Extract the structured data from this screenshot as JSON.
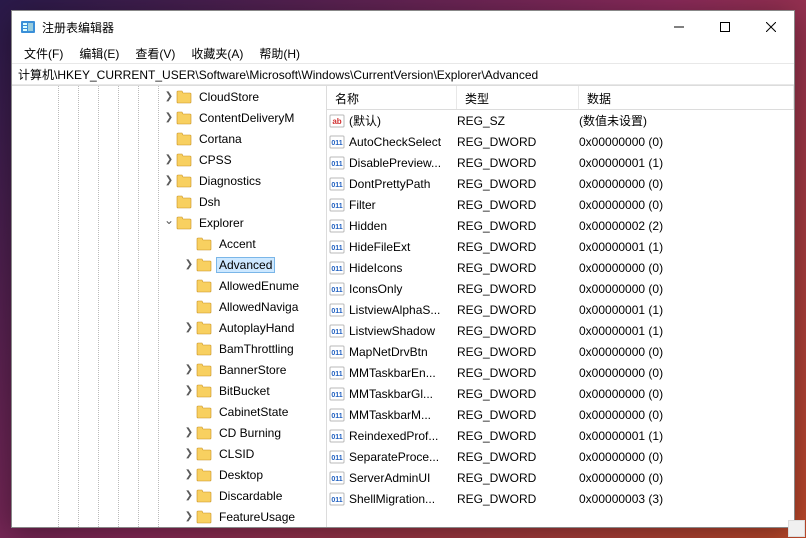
{
  "window": {
    "title": "注册表编辑器"
  },
  "menu": {
    "file": "文件(F)",
    "edit": "编辑(E)",
    "view": "查看(V)",
    "fav": "收藏夹(A)",
    "help": "帮助(H)"
  },
  "address": "计算机\\HKEY_CURRENT_USER\\Software\\Microsoft\\Windows\\CurrentVersion\\Explorer\\Advanced",
  "tree": [
    {
      "indent": 150,
      "chev": "closed",
      "label": "CloudStore"
    },
    {
      "indent": 150,
      "chev": "closed",
      "label": "ContentDeliveryM"
    },
    {
      "indent": 150,
      "chev": "empty",
      "label": "Cortana"
    },
    {
      "indent": 150,
      "chev": "closed",
      "label": "CPSS"
    },
    {
      "indent": 150,
      "chev": "closed",
      "label": "Diagnostics"
    },
    {
      "indent": 150,
      "chev": "empty",
      "label": "Dsh"
    },
    {
      "indent": 150,
      "chev": "open",
      "label": "Explorer"
    },
    {
      "indent": 170,
      "chev": "empty",
      "label": "Accent"
    },
    {
      "indent": 170,
      "chev": "closed",
      "label": "Advanced",
      "sel": true
    },
    {
      "indent": 170,
      "chev": "empty",
      "label": "AllowedEnume"
    },
    {
      "indent": 170,
      "chev": "empty",
      "label": "AllowedNaviga"
    },
    {
      "indent": 170,
      "chev": "closed",
      "label": "AutoplayHand"
    },
    {
      "indent": 170,
      "chev": "empty",
      "label": "BamThrottling"
    },
    {
      "indent": 170,
      "chev": "closed",
      "label": "BannerStore"
    },
    {
      "indent": 170,
      "chev": "closed",
      "label": "BitBucket"
    },
    {
      "indent": 170,
      "chev": "empty",
      "label": "CabinetState"
    },
    {
      "indent": 170,
      "chev": "closed",
      "label": "CD Burning"
    },
    {
      "indent": 170,
      "chev": "closed",
      "label": "CLSID"
    },
    {
      "indent": 170,
      "chev": "closed",
      "label": "Desktop"
    },
    {
      "indent": 170,
      "chev": "closed",
      "label": "Discardable"
    },
    {
      "indent": 170,
      "chev": "closed",
      "label": "FeatureUsage"
    }
  ],
  "columns": {
    "name": "名称",
    "type": "类型",
    "data": "数据"
  },
  "rows": [
    {
      "kind": "sz",
      "name": "(默认)",
      "type": "REG_SZ",
      "data": "(数值未设置)"
    },
    {
      "kind": "dw",
      "name": "AutoCheckSelect",
      "type": "REG_DWORD",
      "data": "0x00000000 (0)"
    },
    {
      "kind": "dw",
      "name": "DisablePreview...",
      "type": "REG_DWORD",
      "data": "0x00000001 (1)"
    },
    {
      "kind": "dw",
      "name": "DontPrettyPath",
      "type": "REG_DWORD",
      "data": "0x00000000 (0)"
    },
    {
      "kind": "dw",
      "name": "Filter",
      "type": "REG_DWORD",
      "data": "0x00000000 (0)"
    },
    {
      "kind": "dw",
      "name": "Hidden",
      "type": "REG_DWORD",
      "data": "0x00000002 (2)"
    },
    {
      "kind": "dw",
      "name": "HideFileExt",
      "type": "REG_DWORD",
      "data": "0x00000001 (1)"
    },
    {
      "kind": "dw",
      "name": "HideIcons",
      "type": "REG_DWORD",
      "data": "0x00000000 (0)"
    },
    {
      "kind": "dw",
      "name": "IconsOnly",
      "type": "REG_DWORD",
      "data": "0x00000000 (0)"
    },
    {
      "kind": "dw",
      "name": "ListviewAlphaS...",
      "type": "REG_DWORD",
      "data": "0x00000001 (1)"
    },
    {
      "kind": "dw",
      "name": "ListviewShadow",
      "type": "REG_DWORD",
      "data": "0x00000001 (1)"
    },
    {
      "kind": "dw",
      "name": "MapNetDrvBtn",
      "type": "REG_DWORD",
      "data": "0x00000000 (0)"
    },
    {
      "kind": "dw",
      "name": "MMTaskbarEn...",
      "type": "REG_DWORD",
      "data": "0x00000000 (0)"
    },
    {
      "kind": "dw",
      "name": "MMTaskbarGl...",
      "type": "REG_DWORD",
      "data": "0x00000000 (0)"
    },
    {
      "kind": "dw",
      "name": "MMTaskbarM...",
      "type": "REG_DWORD",
      "data": "0x00000000 (0)"
    },
    {
      "kind": "dw",
      "name": "ReindexedProf...",
      "type": "REG_DWORD",
      "data": "0x00000001 (1)"
    },
    {
      "kind": "dw",
      "name": "SeparateProce...",
      "type": "REG_DWORD",
      "data": "0x00000000 (0)"
    },
    {
      "kind": "dw",
      "name": "ServerAdminUI",
      "type": "REG_DWORD",
      "data": "0x00000000 (0)"
    },
    {
      "kind": "dw",
      "name": "ShellMigration...",
      "type": "REG_DWORD",
      "data": "0x00000003 (3)"
    }
  ],
  "icons": {
    "app": "regedit-icon",
    "folder": "#F8D060",
    "folder_stroke": "#C89020"
  }
}
